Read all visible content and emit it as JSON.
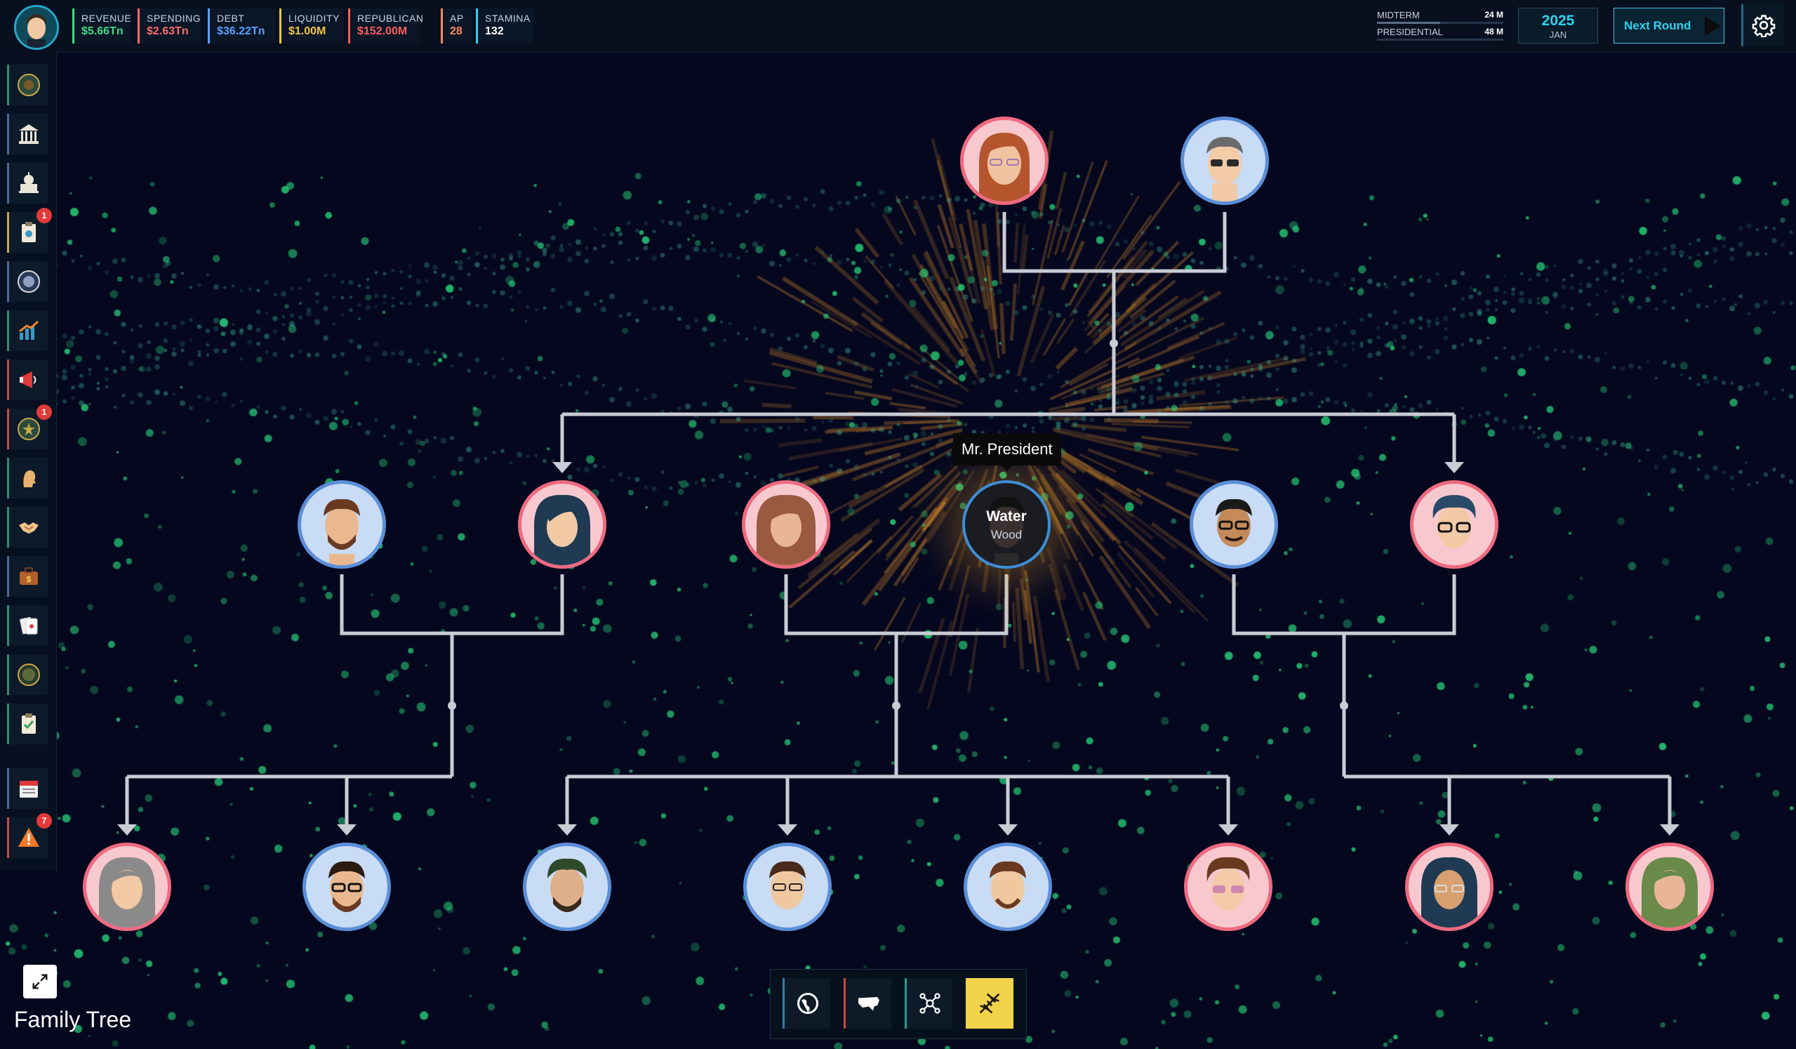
{
  "topbar": {
    "stats": [
      {
        "label": "REVENUE",
        "value": "$5.66Tn",
        "color": "#3ddc84"
      },
      {
        "label": "SPENDING",
        "value": "$2.63Tn",
        "color": "#ff6b6b"
      },
      {
        "label": "DEBT",
        "value": "$36.22Tn",
        "color": "#5aa0ff"
      },
      {
        "label": "LIQUIDITY",
        "value": "$1.00M",
        "color": "#f5c542"
      },
      {
        "label": "REPUBLICAN",
        "value": "$152.00M",
        "color": "#ff5c5c"
      },
      {
        "label": "AP",
        "value": "28",
        "color": "#ff8a65"
      },
      {
        "label": "STAMINA",
        "value": "132",
        "color": "#ffffff"
      }
    ],
    "elections": [
      {
        "label": "MIDTERM",
        "value": "24 M",
        "progress": 0.5
      },
      {
        "label": "PRESIDENTIAL",
        "value": "48 M",
        "progress": 0.0
      }
    ],
    "date": {
      "year": "2025",
      "month": "JAN"
    },
    "next_round_label": "Next Round"
  },
  "sidebar": {
    "items": [
      {
        "icon": "seal-icon",
        "badge": ""
      },
      {
        "icon": "capitol-icon",
        "badge": ""
      },
      {
        "icon": "congress-icon",
        "badge": ""
      },
      {
        "icon": "clipboard-icon",
        "badge": "1"
      },
      {
        "icon": "federal-seal-icon",
        "badge": ""
      },
      {
        "icon": "chart-icon",
        "badge": ""
      },
      {
        "icon": "megaphone-icon",
        "badge": ""
      },
      {
        "icon": "military-icon",
        "badge": "1"
      },
      {
        "icon": "profile-icon",
        "badge": ""
      },
      {
        "icon": "handshake-icon",
        "badge": ""
      },
      {
        "icon": "briefcase-icon",
        "badge": ""
      },
      {
        "icon": "cards-icon",
        "badge": ""
      },
      {
        "icon": "agency-seal-icon",
        "badge": ""
      },
      {
        "icon": "checklist-icon",
        "badge": ""
      },
      {
        "icon": "calendar-icon",
        "badge": ""
      },
      {
        "icon": "warning-icon",
        "badge": "7"
      }
    ]
  },
  "tree": {
    "tooltip": "Mr. President",
    "president": {
      "first": "Water",
      "last": "Wood"
    }
  },
  "bottom": {
    "title": "Family Tree",
    "views": [
      "globe-icon",
      "usa-map-icon",
      "network-icon",
      "dna-icon"
    ],
    "active_view": "dna-icon"
  },
  "colors": {
    "line": "#c9ccd4",
    "female": "#ef6a80",
    "male": "#5b8fd8",
    "accent": "#29d3f0"
  }
}
